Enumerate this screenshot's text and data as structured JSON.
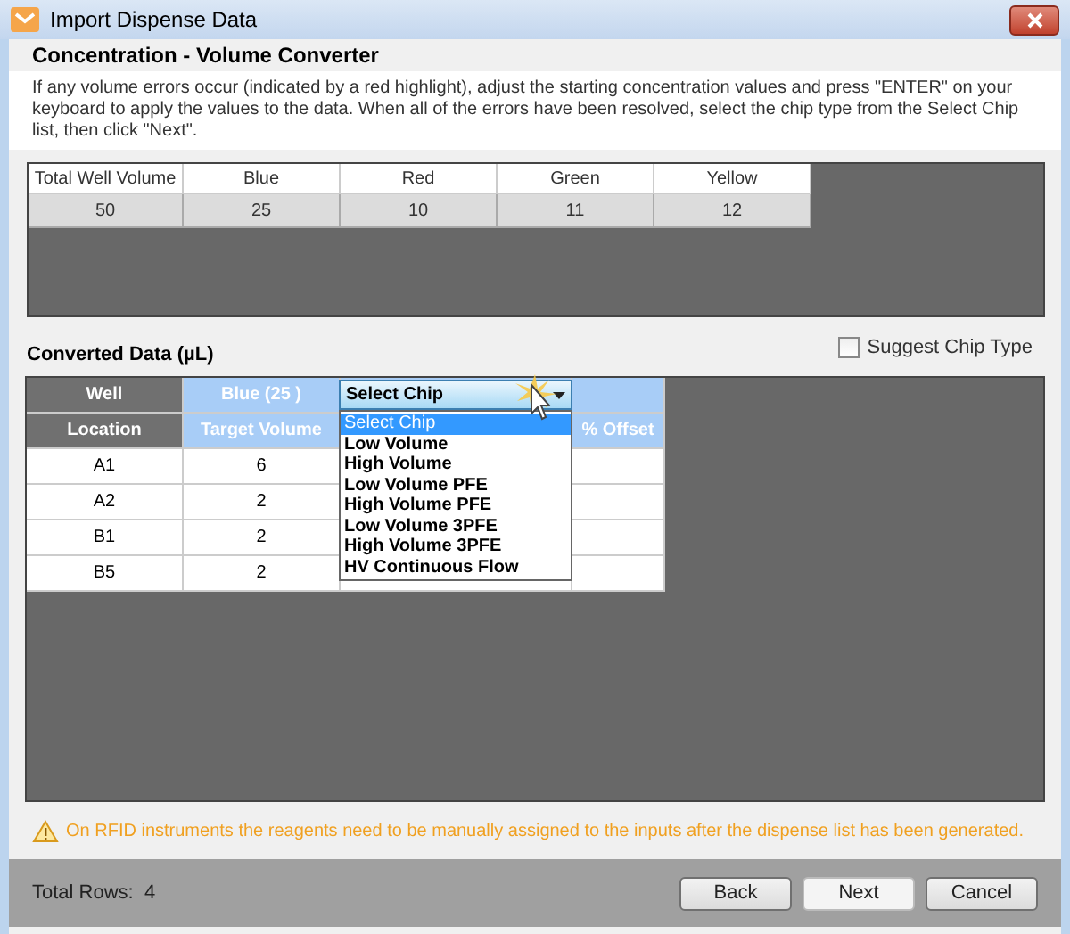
{
  "window": {
    "title": "Import Dispense Data"
  },
  "header": {
    "title": "Concentration - Volume Converter"
  },
  "instructions": "If any volume errors occur (indicated by a red highlight), adjust the starting concentration values and press \"ENTER\" on your keyboard to apply the values to the data. When all of the errors have been resolved, select the chip type from the Select Chip list, then click \"Next\".",
  "concentration_table": {
    "columns": [
      "Total Well Volume",
      "Blue",
      "Red",
      "Green",
      "Yellow"
    ],
    "row": [
      "50",
      "25",
      "10",
      "11",
      "12"
    ]
  },
  "converted_data": {
    "title": "Converted Data (µL)",
    "suggest_chip_type": {
      "label": "Suggest Chip Type",
      "checked": false
    },
    "header_row_1": [
      "Well",
      "Blue (25 )"
    ],
    "header_row_2": [
      "Location",
      "Target Volume"
    ],
    "offset_header": "% Offset",
    "rows": [
      [
        "A1",
        "6"
      ],
      [
        "A2",
        "2"
      ],
      [
        "B1",
        "2"
      ],
      [
        "B5",
        "2"
      ]
    ]
  },
  "chip_dropdown": {
    "value": "Select Chip",
    "options": [
      {
        "label": "Select Chip",
        "selected": true
      },
      {
        "label": "Low Volume",
        "selected": false
      },
      {
        "label": "High Volume",
        "selected": false
      },
      {
        "label": "Low Volume PFE",
        "selected": false
      },
      {
        "label": "High Volume PFE",
        "selected": false
      },
      {
        "label": "Low Volume 3PFE",
        "selected": false
      },
      {
        "label": "High Volume 3PFE",
        "selected": false
      },
      {
        "label": "HV Continuous Flow",
        "selected": false
      }
    ]
  },
  "warning": "On RFID instruments the reagents need to be manually assigned to the inputs after the dispense list has been generated.",
  "status_bar": {
    "total_rows_label": "Total Rows:",
    "total_rows": "4"
  },
  "buttons": [
    "Back",
    "Next",
    "Cancel"
  ]
}
